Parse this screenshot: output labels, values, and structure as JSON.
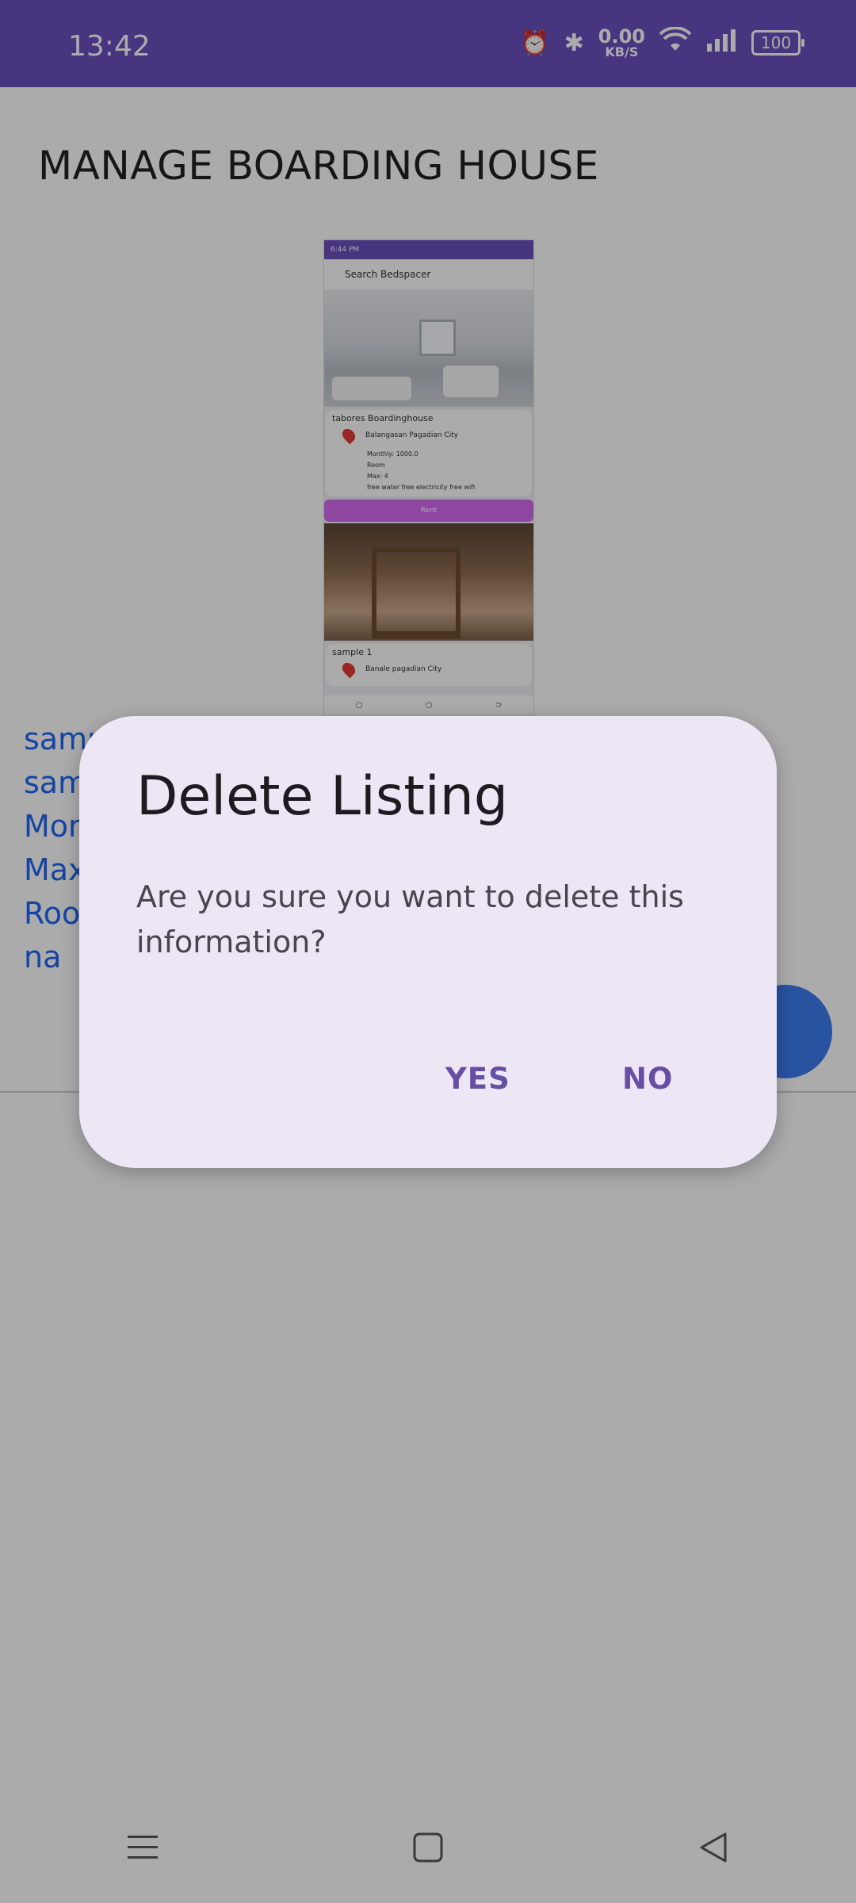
{
  "status_bar": {
    "time": "13:42",
    "net_speed_value": "0.00",
    "net_speed_unit": "KB/S",
    "battery": "100"
  },
  "page": {
    "title": "MANAGE BOARDING HOUSE",
    "preview": {
      "status_time": "6:44 PM",
      "search_placeholder": "Search Bedspacer",
      "card1": {
        "name": "tabores Boardinghouse",
        "address": "Balangasan Pagadian City",
        "monthly": "Monthly: 1000.0",
        "type": "Room",
        "max": "Max: 4",
        "amenities": "free water free electricity free wifi",
        "rent_button": "Rent"
      },
      "card2": {
        "name": "sample 1",
        "address": "Banale pagadian City"
      }
    },
    "listing_lines": [
      "samp",
      "sam",
      "Mor",
      "Max",
      "Roo",
      "na"
    ]
  },
  "dialog": {
    "title": "Delete Listing",
    "message": "Are you sure you want to delete this information?",
    "yes_label": "YES",
    "no_label": "NO"
  },
  "colors": {
    "status_bar": "#6b4fbf",
    "dialog_bg": "#ece6f5",
    "accent": "#6750a4",
    "link_text": "#1e66f5",
    "fab": "#3d7df0"
  }
}
